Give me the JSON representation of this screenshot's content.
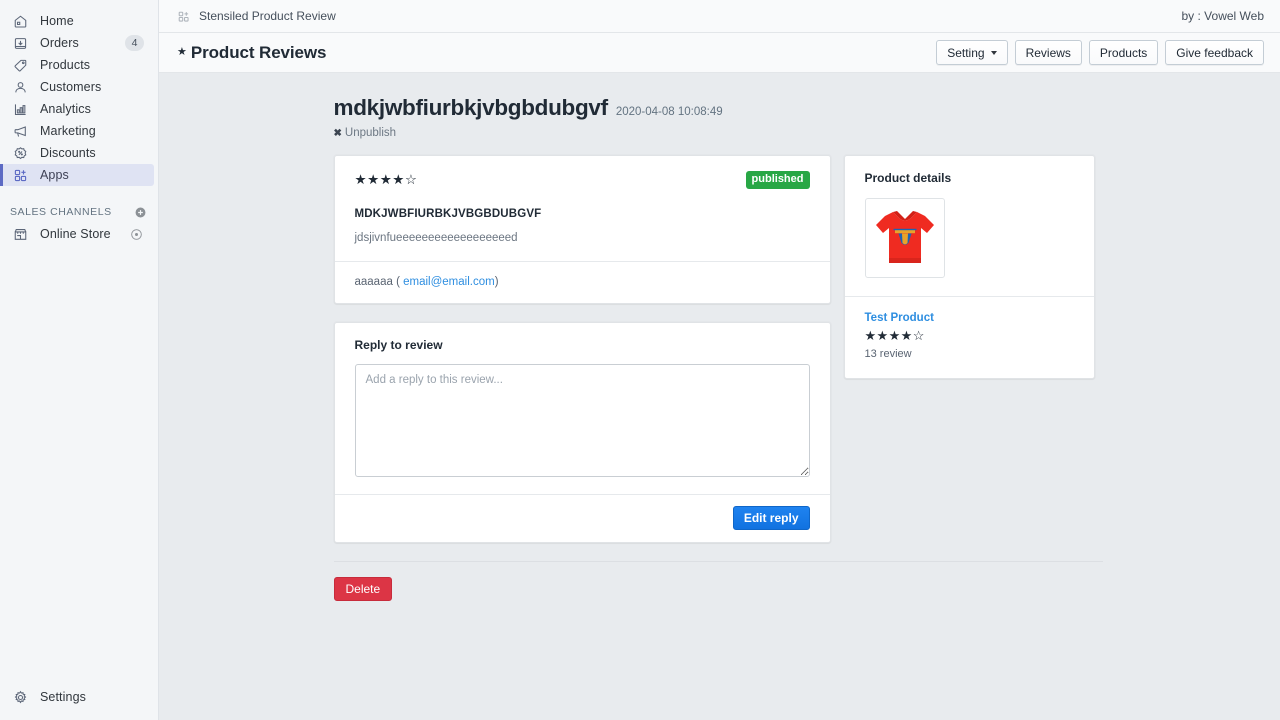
{
  "sidebar": {
    "items": [
      {
        "label": "Home",
        "icon": "home-icon",
        "badge": null
      },
      {
        "label": "Orders",
        "icon": "orders-icon",
        "badge": "4"
      },
      {
        "label": "Products",
        "icon": "products-tag-icon",
        "badge": null
      },
      {
        "label": "Customers",
        "icon": "customers-icon",
        "badge": null
      },
      {
        "label": "Analytics",
        "icon": "analytics-bars-icon",
        "badge": null
      },
      {
        "label": "Marketing",
        "icon": "marketing-megaphone-icon",
        "badge": null
      },
      {
        "label": "Discounts",
        "icon": "discounts-icon",
        "badge": null
      },
      {
        "label": "Apps",
        "icon": "apps-icon",
        "badge": null
      }
    ],
    "sales_channels": {
      "title": "SALES CHANNELS",
      "add_icon": "plus-circle-icon",
      "items": [
        {
          "label": "Online Store",
          "icon": "storefront-icon",
          "action_icon": "eye-icon"
        }
      ]
    },
    "settings": {
      "label": "Settings",
      "icon": "gear-icon"
    }
  },
  "topbar": {
    "app_icon": "apps-grid-icon",
    "app_title": "Stensiled Product Review",
    "author": "by : Vowel Web"
  },
  "pagehead": {
    "star_icon": "star-filled-icon",
    "title": "Product Reviews",
    "buttons": [
      {
        "label": "Setting",
        "has_caret": true
      },
      {
        "label": "Reviews",
        "has_caret": false
      },
      {
        "label": "Products",
        "has_caret": false
      },
      {
        "label": "Give feedback",
        "has_caret": false
      }
    ]
  },
  "review": {
    "title": "mdkjwbfiurbkjvbgbdubgvf",
    "date": "2020-04-08 10:08:49",
    "unpublish_label": "Unpublish",
    "unpublish_icon": "x-icon",
    "stars_display": "★★★★☆",
    "rating": 4,
    "max_rating": 5,
    "status_badge": "published",
    "heading": "MDKJWBFIURBKJVBGBDUBGVF",
    "body": "jdsjivnfueeeeeeeeeeeeeeeeeed",
    "author_name": "aaaaaa",
    "author_open_paren": "(",
    "author_email": "email@email.com",
    "author_close_paren": ")"
  },
  "reply": {
    "title": "Reply to review",
    "textarea_value": "",
    "textarea_placeholder": "Add a reply to this review...",
    "submit_label": "Edit reply"
  },
  "actions": {
    "delete_label": "Delete"
  },
  "product_details": {
    "panel_title": "Product details",
    "thumbnail_icon": "red-tshirt-image",
    "name": "Test Product",
    "stars_display": "★★★★☆",
    "rating": 4,
    "review_count_label": "13 review"
  },
  "colors": {
    "accent_blue": "#1f83f0",
    "link_blue": "#2e8ee0",
    "badge_green": "#28a745",
    "danger_red": "#dc3545",
    "sidebar_active": "#dfe3f3",
    "sidebar_marker": "#5c6ac4",
    "page_bg": "#e8ebee"
  }
}
